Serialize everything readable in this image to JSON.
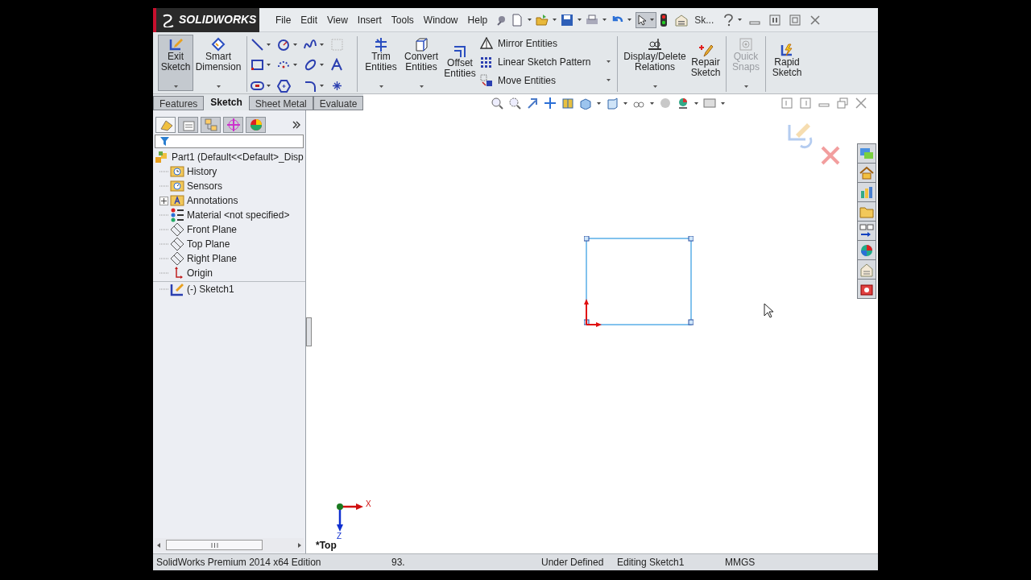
{
  "title_bar": {
    "logo": "SOLIDWORKS",
    "menu": [
      "File",
      "Edit",
      "View",
      "Insert",
      "Tools",
      "Window",
      "Help"
    ],
    "document_label": "Sk..."
  },
  "command_manager": {
    "large_buttons": [
      {
        "label": "Exit Sketch",
        "selected": true,
        "disabled": false
      },
      {
        "label": "Smart Dimension",
        "selected": false,
        "disabled": false
      },
      {
        "label": "Trim Entities",
        "selected": false,
        "disabled": false
      },
      {
        "label": "Convert Entities",
        "selected": false,
        "disabled": false
      },
      {
        "label": "Offset Entities",
        "selected": false,
        "disabled": false
      },
      {
        "label": "Display/Delete Relations",
        "selected": false,
        "disabled": false
      },
      {
        "label": "Repair Sketch",
        "selected": false,
        "disabled": false
      },
      {
        "label": "Quick Snaps",
        "selected": false,
        "disabled": true
      },
      {
        "label": "Rapid Sketch",
        "selected": false,
        "disabled": false
      }
    ],
    "small_buttons": [
      "Mirror Entities",
      "Linear Sketch Pattern",
      "Move Entities"
    ]
  },
  "tabs": [
    {
      "label": "Features",
      "selected": false
    },
    {
      "label": "Sketch",
      "selected": true
    },
    {
      "label": "Sheet Metal",
      "selected": false
    },
    {
      "label": "Evaluate",
      "selected": false
    }
  ],
  "panel_tabs": [
    {
      "selected": true
    },
    {
      "selected": false
    },
    {
      "selected": false
    },
    {
      "selected": false
    },
    {
      "selected": false
    }
  ],
  "feature_tree": {
    "root": "Part1  (Default<<Default>_Disp",
    "children": [
      {
        "label": "History",
        "expandable": false
      },
      {
        "label": "Sensors",
        "expandable": false
      },
      {
        "label": "Annotations",
        "expandable": true
      },
      {
        "label": "Material <not specified>",
        "expandable": false
      },
      {
        "label": "Front Plane",
        "expandable": false
      },
      {
        "label": "Top Plane",
        "expandable": false
      },
      {
        "label": "Right Plane",
        "expandable": false
      },
      {
        "label": "Origin",
        "expandable": false
      },
      {
        "label": "(-) Sketch1",
        "expandable": false
      }
    ]
  },
  "viewport": {
    "view_name": "*Top",
    "triad_labels": [
      "X",
      "Z"
    ]
  },
  "status_bar": [
    "SolidWorks Premium 2014 x64 Edition",
    "93.",
    "Under Defined",
    "Editing Sketch1",
    "MMGS"
  ]
}
